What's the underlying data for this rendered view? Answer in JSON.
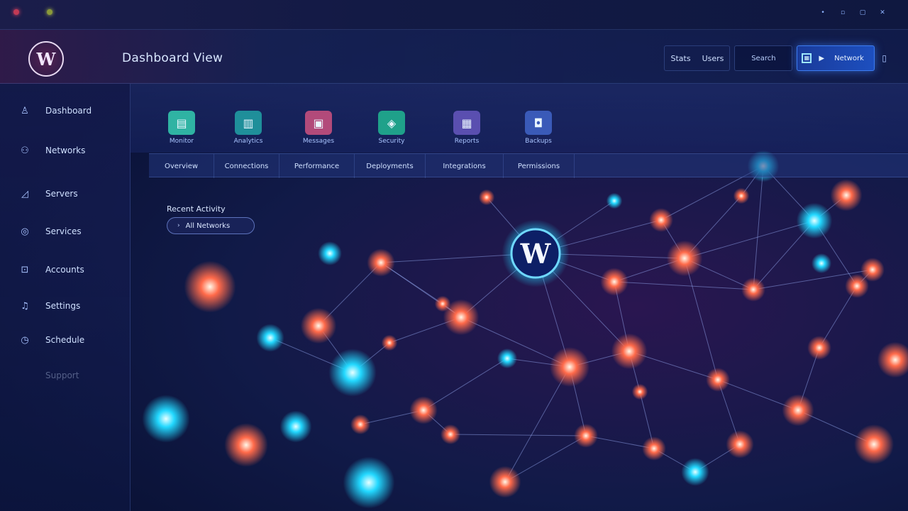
{
  "window": {
    "controls": [
      "minimize-icon",
      "restore-icon",
      "maximize-icon",
      "close-icon"
    ]
  },
  "header": {
    "logo_text": "W",
    "title": "Dashboard View",
    "actions": {
      "btn1": "Stats",
      "btn2": "Users",
      "search": "Search",
      "active_label": "Network",
      "more": "▯"
    }
  },
  "sidebar": {
    "items": [
      {
        "label": "Dashboard",
        "icon": "user-icon"
      },
      {
        "label": "Networks",
        "icon": "people-icon"
      },
      {
        "label": "Servers",
        "icon": "chart-icon"
      },
      {
        "label": "Services",
        "icon": "globe-icon"
      },
      {
        "label": "Accounts",
        "icon": "lock-icon"
      },
      {
        "label": "Settings",
        "icon": "bell-icon"
      },
      {
        "label": "Schedule",
        "icon": "clock-icon"
      },
      {
        "label": "Support"
      }
    ]
  },
  "toolbar": {
    "tools": [
      {
        "label": "Monitor",
        "icon": "monitor-icon",
        "color": "#2fb3a3"
      },
      {
        "label": "Analytics",
        "icon": "analytics-icon",
        "color": "#1f8f9a"
      },
      {
        "label": "Messages",
        "icon": "messages-icon",
        "color": "#b24a7a"
      },
      {
        "label": "Security",
        "icon": "shield-icon",
        "color": "#1fa18a"
      },
      {
        "label": "Reports",
        "icon": "reports-icon",
        "color": "#5a4fb0"
      },
      {
        "label": "Backups",
        "icon": "backup-icon",
        "color": "#3a5ab8"
      }
    ],
    "tabs": [
      "Overview",
      "Connections",
      "Performance",
      "Deployments",
      "Integrations",
      "Permissions"
    ]
  },
  "main": {
    "section_label": "Recent Activity",
    "filter_label": "All Networks"
  },
  "colors": {
    "accent": "#3d7cf0",
    "node_warm": "#ff6a4a",
    "node_cool": "#22d8ff",
    "background": "#0a1236"
  }
}
